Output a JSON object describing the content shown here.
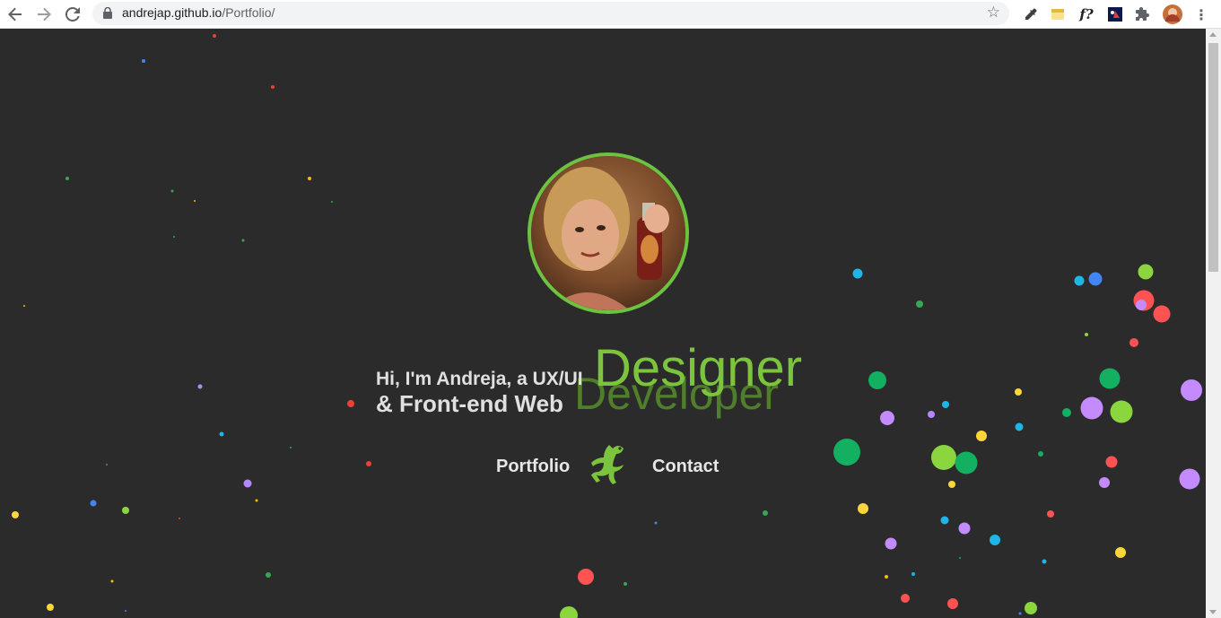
{
  "browser": {
    "url_domain": "andrejap.github.io",
    "url_path": "/Portfolio/",
    "icons": [
      "back-arrow-icon",
      "forward-arrow-icon",
      "reload-icon",
      "lock-icon",
      "star-icon",
      "eyedropper-icon",
      "note-icon",
      "font-icon",
      "app-icon",
      "puzzle-icon",
      "profile-avatar",
      "menu-icon"
    ],
    "ext_font_label": "f?",
    "menu_glyph": "⋮"
  },
  "hero": {
    "intro_line1": "Hi, I'm Andreja, a UX/UI",
    "intro_line2": "& Front-end Web",
    "role_front": "Designer",
    "role_back": "Developer",
    "accent_color": "#7cc43c"
  },
  "nav": {
    "portfolio_label": "Portfolio",
    "contact_label": "Contact",
    "logo_icon": "lizard-logo-icon"
  },
  "colors": {
    "background": "#2b2b2b",
    "particles": [
      "#4285f4",
      "#ea4335",
      "#34a853",
      "#fbbc05",
      "#b388ff",
      "#1fb5e6",
      "#8bd63f",
      "#ff5252",
      "#12b060",
      "#ffd63a",
      "#c48bff"
    ]
  }
}
